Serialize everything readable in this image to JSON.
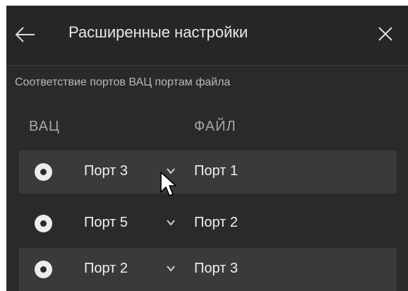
{
  "header": {
    "title": "Расширенные настройки",
    "back_icon": "arrow-left-icon",
    "close_icon": "close-icon"
  },
  "section": {
    "subtitle": "Соответствие портов ВАЦ портам файла",
    "col_vac": "ВАЦ",
    "col_file": "ФАЙЛ"
  },
  "rows": [
    {
      "vac": "Порт 3",
      "file": "Порт 1",
      "shaded": true
    },
    {
      "vac": "Порт 5",
      "file": "Порт 2",
      "shaded": false
    },
    {
      "vac": "Порт 2",
      "file": "Порт 3",
      "shaded": true
    }
  ],
  "colors": {
    "panel_bg": "#2a2a2a",
    "row_shade": "#3a3a3a",
    "text": "#f0f0f0",
    "muted": "#a6a6a6"
  }
}
